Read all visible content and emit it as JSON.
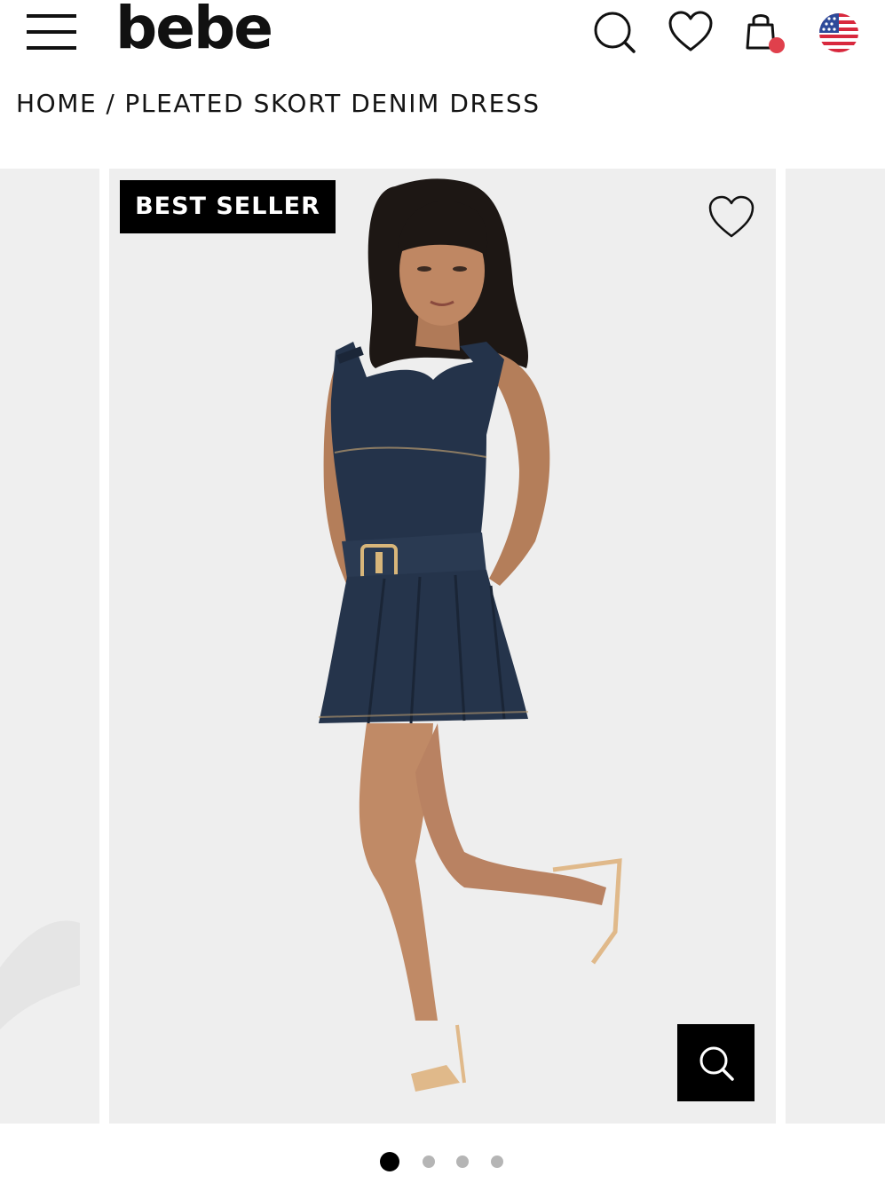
{
  "header": {
    "logo_text": "bebe",
    "menu_icon": "hamburger-menu-icon",
    "search_icon": "search-icon",
    "wishlist_icon": "heart-icon",
    "bag_icon": "shopping-bag-icon",
    "bag_indicator_color": "#e0404c",
    "region_icon": "us-flag-icon"
  },
  "breadcrumb": {
    "home": "HOME",
    "separator": "/",
    "current": "PLEATED SKORT DENIM DRESS"
  },
  "product": {
    "badge": "BEST SELLER",
    "wishlist_icon": "heart-outline-icon",
    "zoom_icon": "search-zoom-icon"
  },
  "carousel": {
    "total_slides": 4,
    "active_slide": 1
  },
  "colors": {
    "badge_bg": "#000000",
    "slide_bg": "#eeeeee",
    "dot_active": "#000000",
    "dot_inactive": "#b5b5b5"
  }
}
